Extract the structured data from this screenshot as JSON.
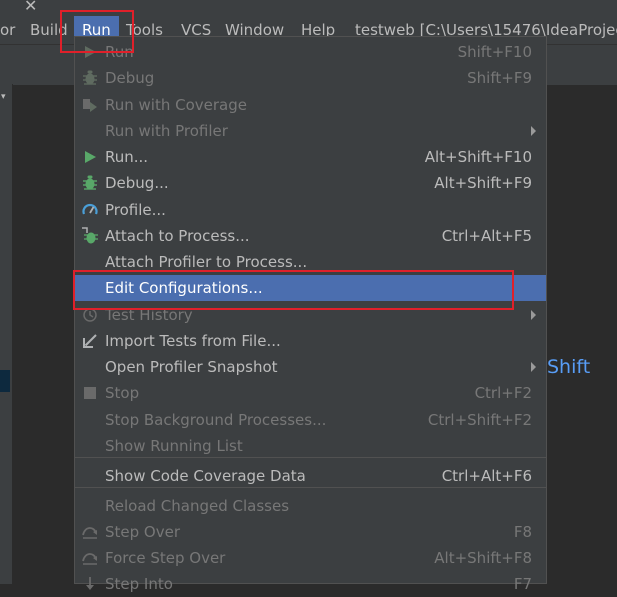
{
  "menubar": {
    "items": [
      "or",
      "Build",
      "Run",
      "Tools",
      "VCS",
      "Window",
      "Help"
    ],
    "title": "testweb [C:\\Users\\15476\\IdeaProjec"
  },
  "editor": {
    "hint": "Shift"
  },
  "run_menu": {
    "items": [
      {
        "label": "Run",
        "shortcut": "Shift+F10",
        "icon": "run-icon",
        "enabled": false
      },
      {
        "label": "Debug",
        "shortcut": "Shift+F9",
        "icon": "debug-icon",
        "enabled": false
      },
      {
        "label": "Run with Coverage",
        "shortcut": "",
        "icon": "coverage-icon",
        "enabled": false
      },
      {
        "label": "Run with Profiler",
        "shortcut": "",
        "icon": "",
        "enabled": false,
        "submenu": true
      },
      {
        "label": "Run...",
        "shortcut": "Alt+Shift+F10",
        "icon": "run-icon",
        "enabled": true
      },
      {
        "label": "Debug...",
        "shortcut": "Alt+Shift+F9",
        "icon": "debug-icon",
        "enabled": true
      },
      {
        "label": "Profile...",
        "shortcut": "",
        "icon": "profile-icon",
        "enabled": true
      },
      {
        "label": "Attach to Process...",
        "shortcut": "Ctrl+Alt+F5",
        "icon": "attach-icon",
        "enabled": true
      },
      {
        "label": "Attach Profiler to Process...",
        "shortcut": "",
        "icon": "",
        "enabled": true
      },
      {
        "label": "Edit Configurations...",
        "shortcut": "",
        "icon": "",
        "enabled": true,
        "selected": true
      },
      {
        "label": "Test History",
        "shortcut": "",
        "icon": "history-icon",
        "enabled": false,
        "submenu": true
      },
      {
        "label": "Import Tests from File...",
        "shortcut": "",
        "icon": "import-icon",
        "enabled": true
      },
      {
        "label": "Open Profiler Snapshot",
        "shortcut": "",
        "icon": "",
        "enabled": true,
        "submenu": true
      },
      {
        "label": "Stop",
        "shortcut": "Ctrl+F2",
        "icon": "stop-icon",
        "enabled": false
      },
      {
        "label": "Stop Background Processes...",
        "shortcut": "Ctrl+Shift+F2",
        "icon": "",
        "enabled": false
      },
      {
        "label": "Show Running List",
        "shortcut": "",
        "icon": "",
        "enabled": false
      },
      {
        "label": "Show Code Coverage Data",
        "shortcut": "Ctrl+Alt+F6",
        "icon": "",
        "enabled": true
      },
      {
        "label": "Reload Changed Classes",
        "shortcut": "",
        "icon": "",
        "enabled": false
      },
      {
        "label": "Step Over",
        "shortcut": "F8",
        "icon": "step-over-icon",
        "enabled": false
      },
      {
        "label": "Force Step Over",
        "shortcut": "Alt+Shift+F8",
        "icon": "step-over-icon",
        "enabled": false
      },
      {
        "label": "Step Into",
        "shortcut": "F7",
        "icon": "step-into-icon",
        "enabled": false
      }
    ]
  },
  "colors": {
    "menu_bg": "#3c3f41",
    "selection": "#4b6eaf",
    "highlight_box": "#e0202a",
    "run_green": "#59a869"
  }
}
